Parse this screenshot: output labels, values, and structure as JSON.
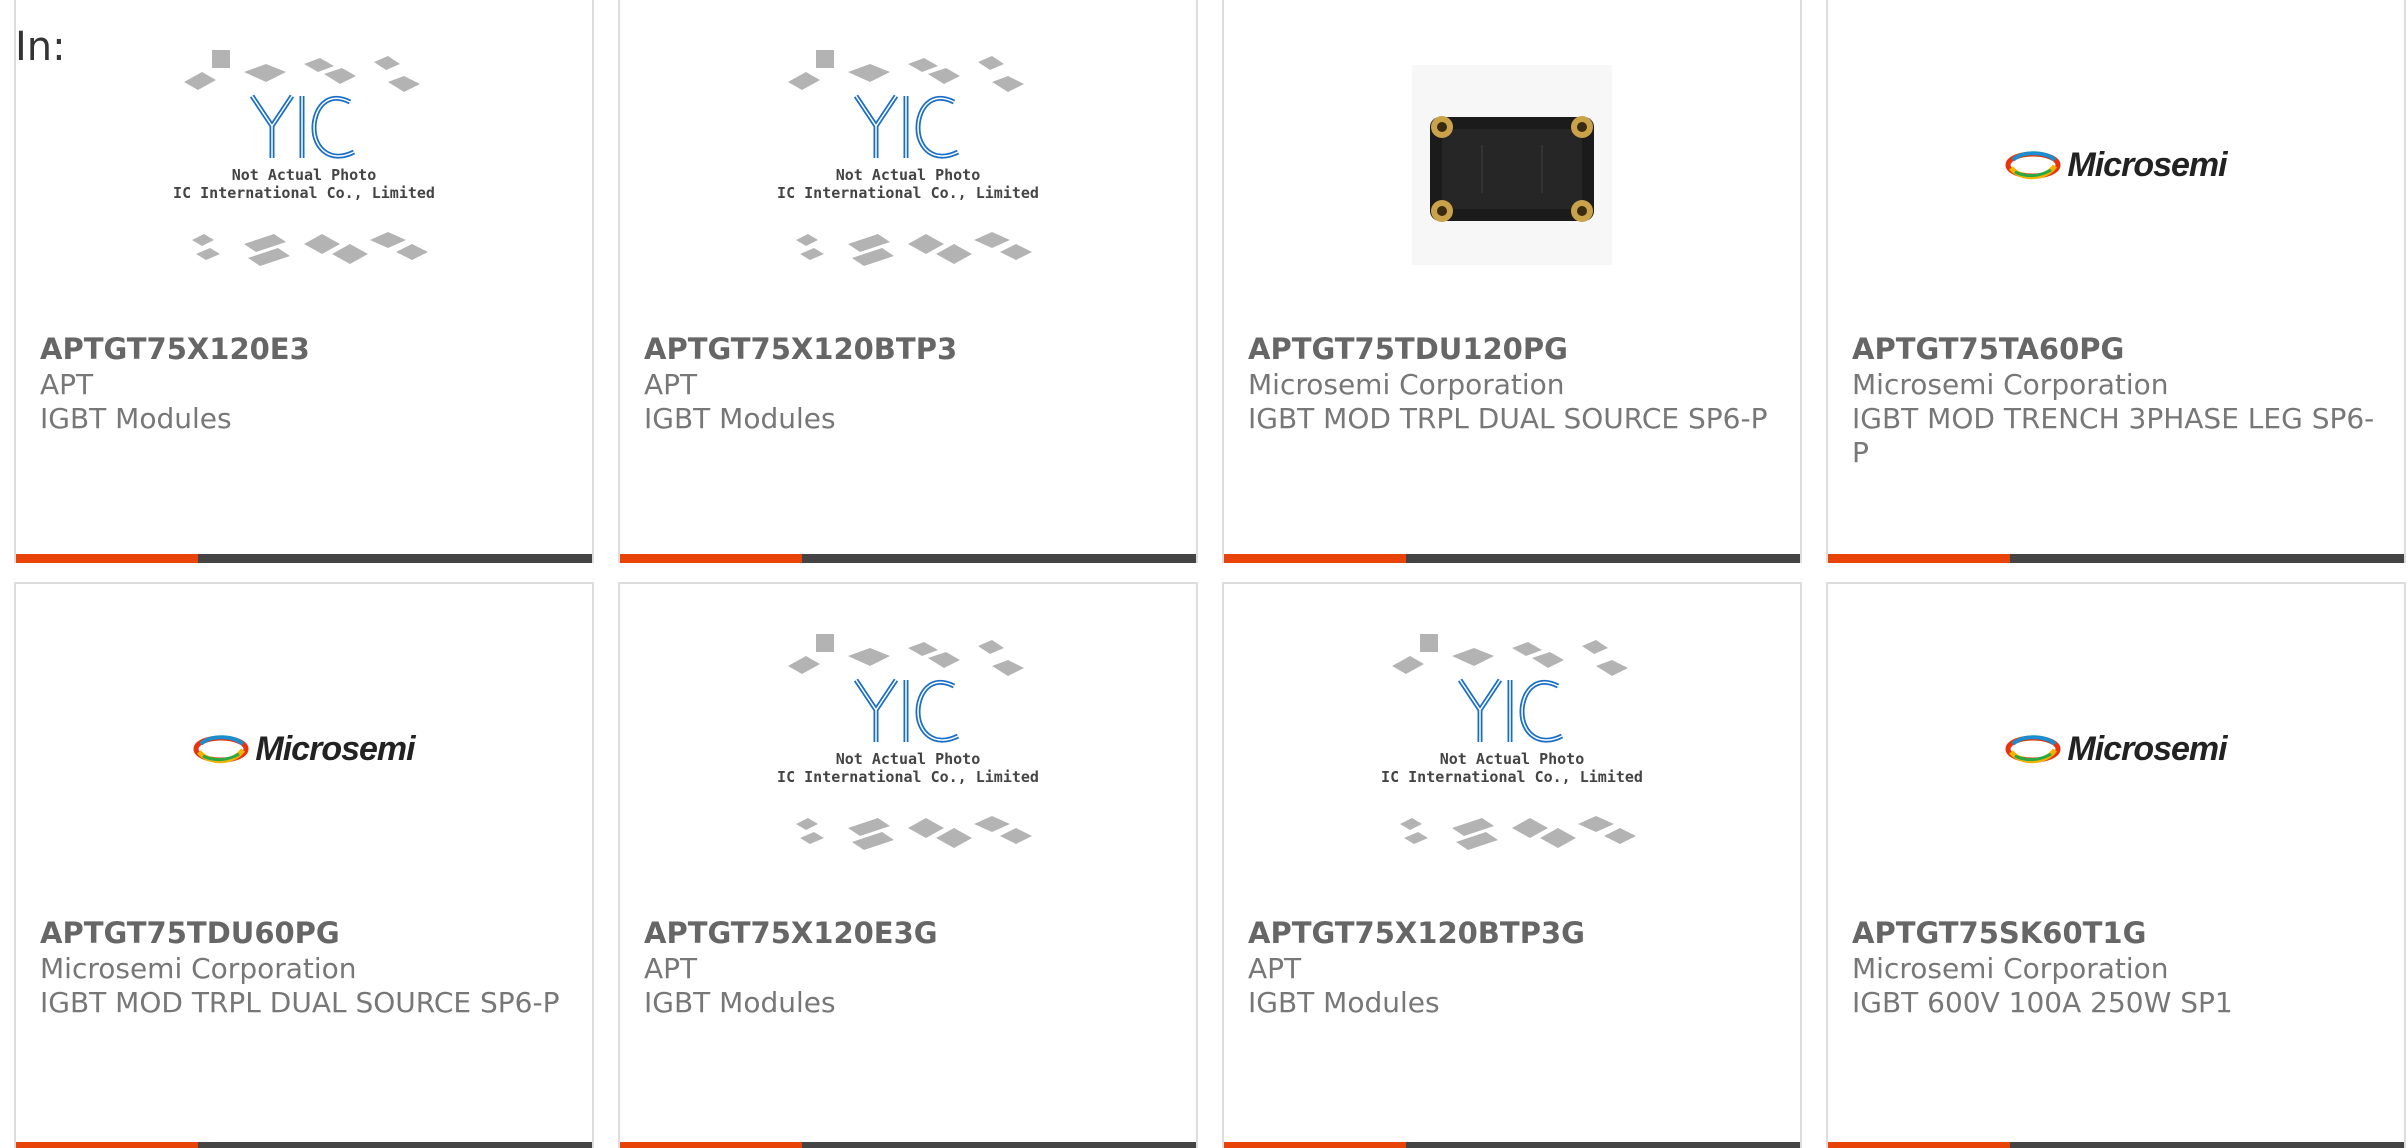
{
  "header": {
    "in_label": "In:"
  },
  "placeholder": {
    "line1": "Not Actual Photo",
    "line2": "YIC International Co., Limited.",
    "logo_text": "YIC"
  },
  "microsemi_logo": {
    "text": "Microsemi"
  },
  "colors": {
    "accent": "#e8440a",
    "bar": "#444444",
    "yic_blue": "#1a6fc4"
  },
  "products": [
    {
      "part": "APTGT75X120E3",
      "manufacturer": "APT",
      "description": "IGBT Modules",
      "image": "yic-placeholder"
    },
    {
      "part": "APTGT75X120BTP3",
      "manufacturer": "APT",
      "description": "IGBT Modules",
      "image": "yic-placeholder"
    },
    {
      "part": "APTGT75TDU120PG",
      "manufacturer": "Microsemi Corporation",
      "description": "IGBT MOD TRPL DUAL SOURCE SP6-P",
      "image": "module-photo"
    },
    {
      "part": "APTGT75TA60PG",
      "manufacturer": "Microsemi Corporation",
      "description": "IGBT MOD TRENCH 3PHASE LEG SP6-P",
      "image": "microsemi-logo"
    },
    {
      "part": "APTGT75TDU60PG",
      "manufacturer": "Microsemi Corporation",
      "description": "IGBT MOD TRPL DUAL SOURCE SP6-P",
      "image": "microsemi-logo"
    },
    {
      "part": "APTGT75X120E3G",
      "manufacturer": "APT",
      "description": "IGBT Modules",
      "image": "yic-placeholder"
    },
    {
      "part": "APTGT75X120BTP3G",
      "manufacturer": "APT",
      "description": "IGBT Modules",
      "image": "yic-placeholder"
    },
    {
      "part": "APTGT75SK60T1G",
      "manufacturer": "Microsemi Corporation",
      "description": "IGBT 600V 100A 250W SP1",
      "image": "microsemi-logo"
    }
  ]
}
